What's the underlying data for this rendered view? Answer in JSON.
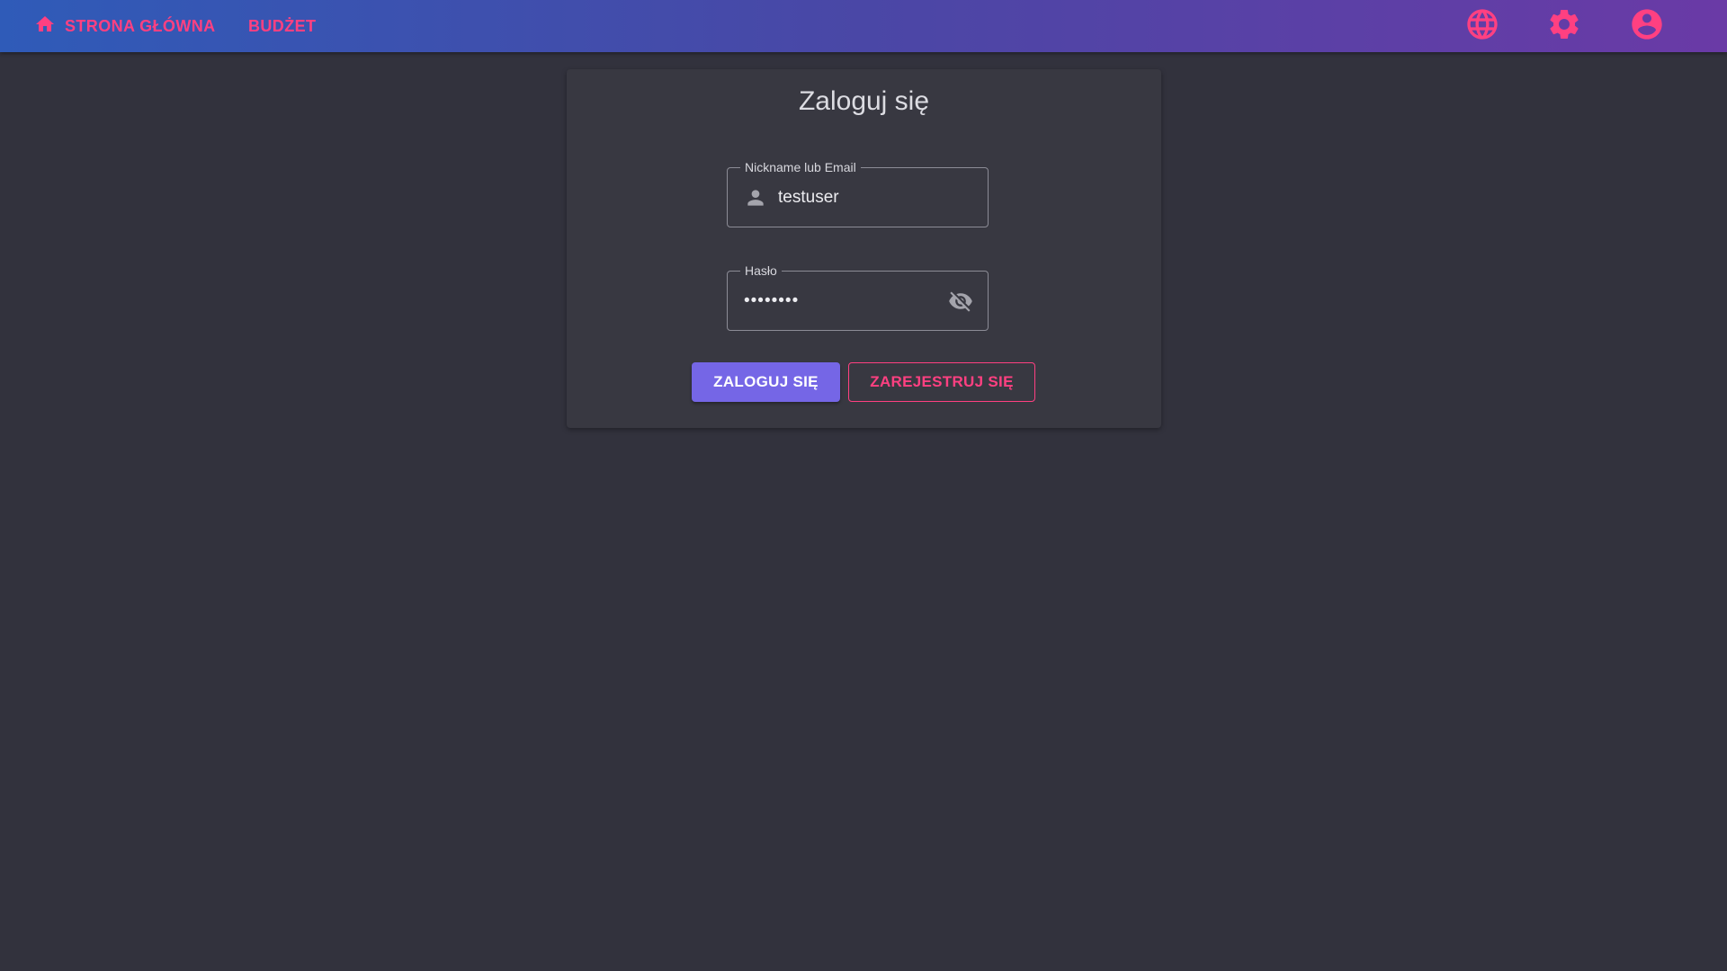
{
  "colors": {
    "accent": "#ff4081",
    "primary": "#7566e6",
    "background": "#32323d",
    "card": "#383841",
    "topbar_gradient_start": "#2f5bb8",
    "topbar_gradient_end": "#6a3aa6"
  },
  "topbar": {
    "home_label": "STRONA GŁÓWNA",
    "budget_label": "BUDŻET",
    "icons": [
      "home-icon",
      "globe-icon",
      "gear-icon",
      "account-circle-icon"
    ]
  },
  "login": {
    "title": "Zaloguj się",
    "username": {
      "label": "Nickname lub Email",
      "value": "testuser",
      "icon": "person-icon"
    },
    "password": {
      "label": "Hasło",
      "value": "••••••••",
      "icon": "eye-off-icon"
    },
    "login_button": "ZALOGUJ SIĘ",
    "register_button": "ZAREJESTRUJ SIĘ"
  }
}
